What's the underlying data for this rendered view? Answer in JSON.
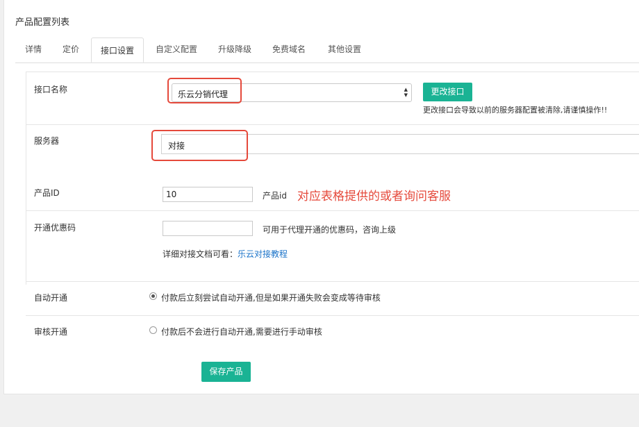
{
  "panel": {
    "title": "产品配置列表"
  },
  "tabs": [
    {
      "label": "详情"
    },
    {
      "label": "定价"
    },
    {
      "label": "接口设置",
      "active": true
    },
    {
      "label": "自定义配置"
    },
    {
      "label": "升级降级"
    },
    {
      "label": "免费域名"
    },
    {
      "label": "其他设置"
    }
  ],
  "interface": {
    "label": "接口名称",
    "selected": "乐云分销代理",
    "change_button": "更改接口",
    "warning": "更改接口会导致以前的服务器配置被清除,请谨慎操作!!"
  },
  "server": {
    "label": "服务器",
    "value": "对接"
  },
  "product_id": {
    "label": "产品ID",
    "value": "10",
    "hint": "产品id",
    "annotation": "对应表格提供的或者询问客服"
  },
  "coupon": {
    "label": "开通优惠码",
    "value": "",
    "hint": "可用于代理开通的优惠码，咨询上级",
    "doc_prefix": "详细对接文档可看：",
    "doc_link": "乐云对接教程"
  },
  "auto_open": {
    "label": "自动开通",
    "option": "付款后立刻尝试自动开通,但是如果开通失败会变成等待审核",
    "checked": true
  },
  "review_open": {
    "label": "审核开通",
    "option": "付款后不会进行自动开通,需要进行手动审核",
    "checked": false
  },
  "save_button": "保存产品",
  "colors": {
    "accent": "#1ab394",
    "annotation_red": "#e5493b",
    "link": "#1a73c9"
  }
}
